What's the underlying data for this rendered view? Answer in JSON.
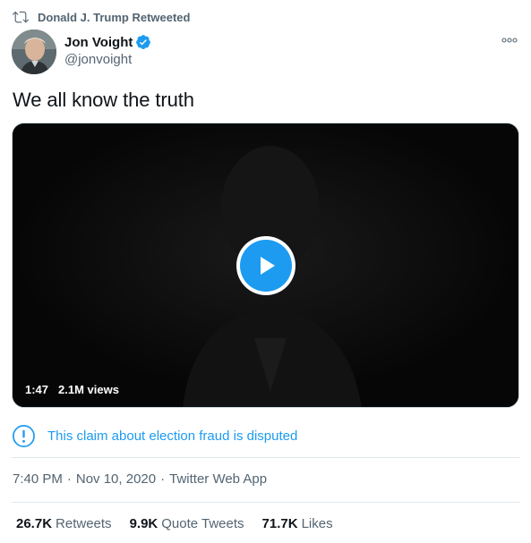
{
  "social_context": {
    "label": "Donald J. Trump Retweeted"
  },
  "author": {
    "name": "Jon Voight",
    "handle": "@jonvoight",
    "verified": true
  },
  "tweet": {
    "text": "We all know the truth"
  },
  "video": {
    "duration": "1:47",
    "views": "2.1M views"
  },
  "warning": {
    "text": "This claim about election fraud is disputed"
  },
  "meta": {
    "time": "7:40 PM",
    "separator": "·",
    "date": "Nov 10, 2020",
    "source": "Twitter Web App"
  },
  "stats": [
    {
      "count": "26.7K",
      "label": "Retweets"
    },
    {
      "count": "9.9K",
      "label": "Quote Tweets"
    },
    {
      "count": "71.7K",
      "label": "Likes"
    }
  ],
  "colors": {
    "accent": "#1d9bf0",
    "secondary_text": "#536471",
    "primary_text": "#0f1419",
    "video_background": "#070707"
  },
  "icons": {
    "retweet": "retweet-icon",
    "verified": "verified-badge-icon",
    "more": "more-options-icon",
    "play": "play-icon",
    "warning": "info-warning-icon"
  }
}
